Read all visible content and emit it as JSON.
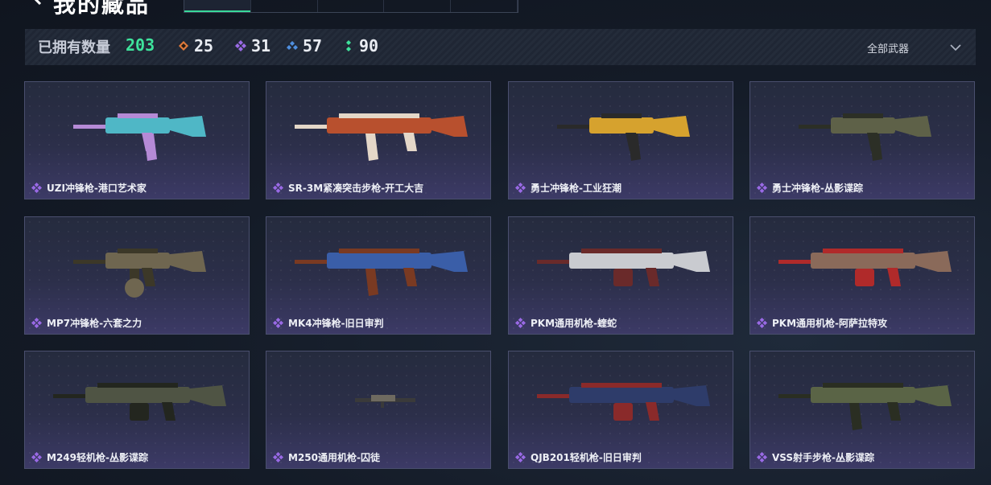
{
  "header": {
    "title": "我的藏品",
    "tabs": [
      {
        "label": "",
        "active": true
      },
      {
        "label": "",
        "active": false
      },
      {
        "label": "",
        "active": false
      },
      {
        "label": "",
        "active": false
      },
      {
        "label": "",
        "active": false
      }
    ]
  },
  "stats": {
    "owned_label": "已拥有数量",
    "owned_count": "203",
    "rarities": [
      {
        "icon": "orange-diamond-icon",
        "color": "#e07a3a",
        "count": "25"
      },
      {
        "icon": "purple-diamond-icon",
        "color": "#9a6ae6",
        "count": "31"
      },
      {
        "icon": "blue-diamond-icon",
        "color": "#4f8fe0",
        "count": "57"
      },
      {
        "icon": "green-diamond-icon",
        "color": "#3ee39c",
        "count": "90"
      }
    ],
    "filter_label": "全部武器"
  },
  "accent": "#3ee39c",
  "items": [
    {
      "name": "UZI冲锋枪-港口艺术家",
      "rarity_color": "#9a6ae6",
      "gun_color": "#4fb7c6",
      "accent_color": "#b58ad6",
      "gun_type": "smg"
    },
    {
      "name": "SR-3M紧凑突击步枪-开工大吉",
      "rarity_color": "#9a6ae6",
      "gun_color": "#b8502e",
      "accent_color": "#e4d7c8",
      "gun_type": "rifle"
    },
    {
      "name": "勇士冲锋枪-工业狂潮",
      "rarity_color": "#9a6ae6",
      "gun_color": "#d6a22e",
      "accent_color": "#2a2a2a",
      "gun_type": "smg"
    },
    {
      "name": "勇士冲锋枪-丛影谍踪",
      "rarity_color": "#9a6ae6",
      "gun_color": "#5e6148",
      "accent_color": "#2c2f26",
      "gun_type": "smg"
    },
    {
      "name": "MP7冲锋枪-六套之力",
      "rarity_color": "#9a6ae6",
      "gun_color": "#6f6650",
      "accent_color": "#3c3828",
      "gun_type": "drum"
    },
    {
      "name": "MK4冲锋枪-旧日审判",
      "rarity_color": "#9a6ae6",
      "gun_color": "#3a5ea8",
      "accent_color": "#7a3a22",
      "gun_type": "rifle"
    },
    {
      "name": "PKM通用机枪-蝰蛇",
      "rarity_color": "#9a6ae6",
      "gun_color": "#c9cbd0",
      "accent_color": "#6a2a2a",
      "gun_type": "lmg"
    },
    {
      "name": "PKM通用机枪-阿萨拉特攻",
      "rarity_color": "#9a6ae6",
      "gun_color": "#8a6a5a",
      "accent_color": "#b02a2a",
      "gun_type": "lmg"
    },
    {
      "name": "M249轻机枪-丛影谍踪",
      "rarity_color": "#9a6ae6",
      "gun_color": "#4f5444",
      "accent_color": "#23261f",
      "gun_type": "lmg"
    },
    {
      "name": "M250通用机枪-囚徒",
      "rarity_color": "#9a6ae6",
      "gun_color": "#6e6a60",
      "accent_color": "#3a3a3a",
      "gun_type": "small"
    },
    {
      "name": "QJB201轻机枪-旧日审判",
      "rarity_color": "#9a6ae6",
      "gun_color": "#2e3c6a",
      "accent_color": "#8a2a2a",
      "gun_type": "lmg"
    },
    {
      "name": "VSS射手步枪-丛影谍踪",
      "rarity_color": "#9a6ae6",
      "gun_color": "#5a6446",
      "accent_color": "#2a2e22",
      "gun_type": "rifle"
    }
  ]
}
